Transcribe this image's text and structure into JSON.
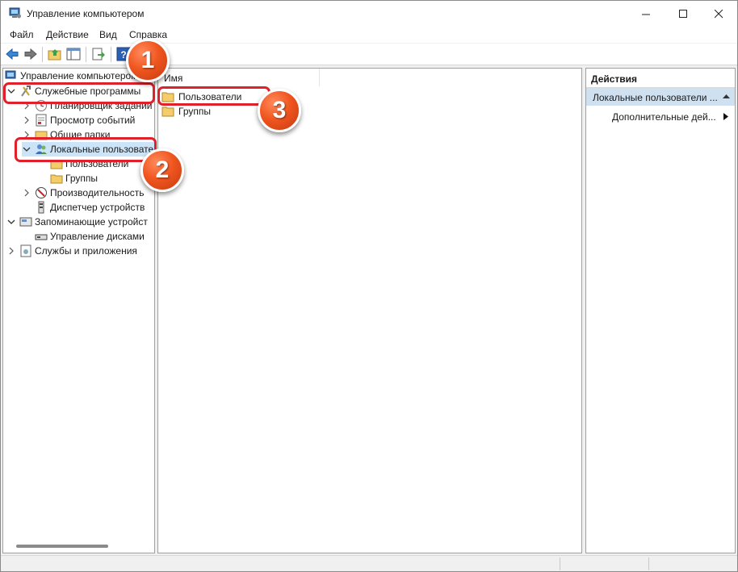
{
  "window": {
    "title": "Управление компьютером"
  },
  "menu": {
    "file": "Файл",
    "action": "Действие",
    "view": "Вид",
    "help": "Справка"
  },
  "tree": {
    "root": "Управление компьютером",
    "system_tools": "Служебные программы",
    "task_scheduler": "Планировщик заданий",
    "event_viewer": "Просмотр событий",
    "shared_folders": "Общие папки",
    "local_users": "Локальные пользовате",
    "users": "Пользователи",
    "groups": "Группы",
    "performance": "Производительность",
    "device_manager": "Диспетчер устройств",
    "storage": "Запоминающие устройст",
    "disk_management": "Управление дисками",
    "services_apps": "Службы и приложения"
  },
  "list": {
    "column_name": "Имя",
    "items": [
      "Пользователи",
      "Группы"
    ]
  },
  "actions": {
    "header": "Действия",
    "section": "Локальные пользователи ...",
    "more": "Дополнительные дей..."
  },
  "badges": {
    "b1": "1",
    "b2": "2",
    "b3": "3"
  },
  "colors": {
    "highlight": "#e0212a",
    "badge": "#f0561f",
    "selection": "#cce4f7",
    "folder": "#f4cd6a"
  }
}
